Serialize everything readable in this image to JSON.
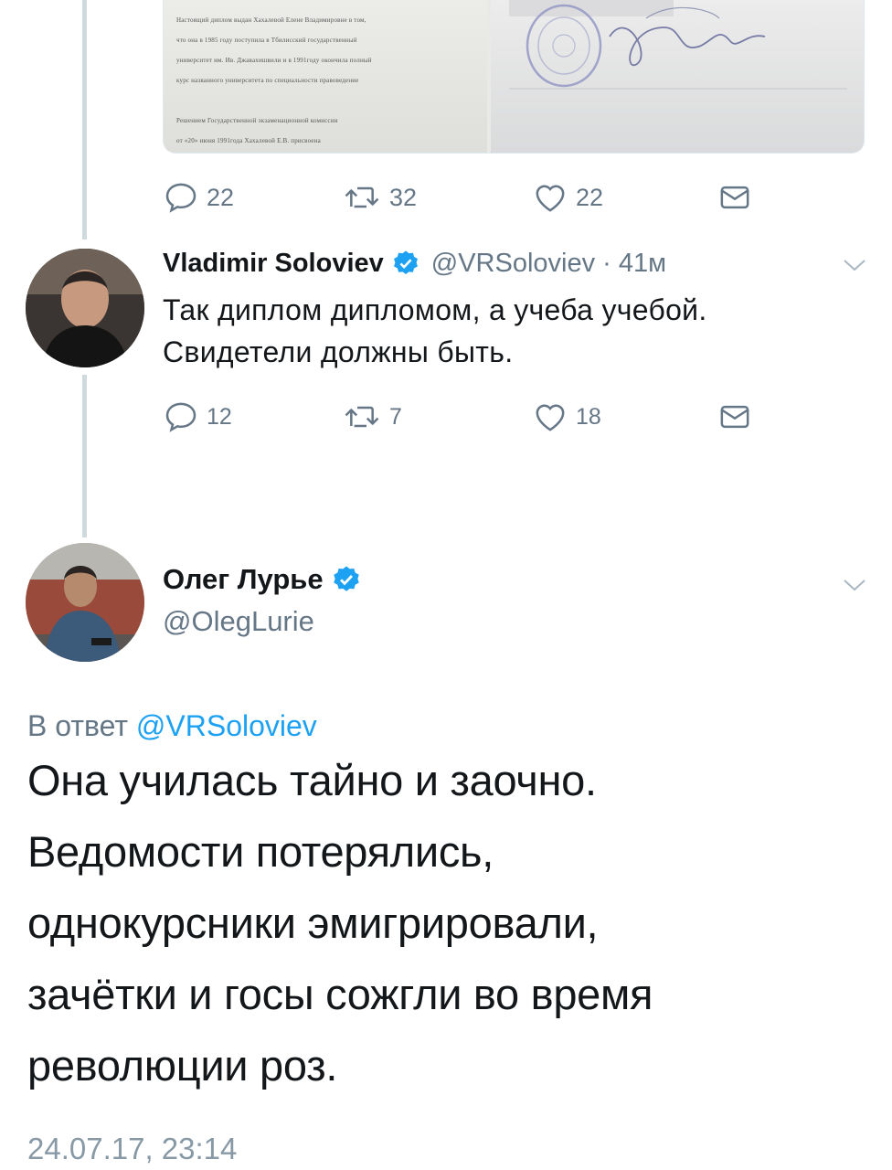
{
  "media_caption": {
    "lines": [
      "Настоящий диплом выдан Хахалевой Елене Владимировне в том,",
      "что она в 1985 году поступила в Тбилисский государственный",
      "университет им. Ив. Джавахишвили и в 1991году окончила полный",
      "курс названного университета по специальности правоведение",
      "Решением Государственной экзаменационной комиссии",
      "от «20» июня 1991года Хахалевой Е.В. присвоена"
    ]
  },
  "top_actions": {
    "replies": "22",
    "retweets": "32",
    "likes": "22"
  },
  "tweet1": {
    "name": "Vladimir Soloviev",
    "handle": "@VRSoloviev",
    "time": "· 41м",
    "text_line1": "Так диплом дипломом, а учеба учебой.",
    "text_line2": "Свидетели должны быть.",
    "actions": {
      "replies": "12",
      "retweets": "7",
      "likes": "18"
    }
  },
  "tweet2": {
    "name": "Олег Лурье",
    "handle": "@OlegLurie",
    "reply_prefix": "В ответ",
    "reply_mention": "@VRSoloviev",
    "lines": [
      "Она училась тайно и заочно.",
      "Ведомости потерялись,",
      "однокурсники эмигрировали,",
      "зачётки и госы сожгли во время",
      "революции роз."
    ],
    "timestamp": "24.07.17, 23:14"
  },
  "colors": {
    "accent": "#1da1f2",
    "secondary": "#657786",
    "thread": "#cfd9de"
  },
  "icons": [
    "reply-icon",
    "retweet-icon",
    "like-icon",
    "dm-icon",
    "verified-icon",
    "chevron-down-icon"
  ]
}
